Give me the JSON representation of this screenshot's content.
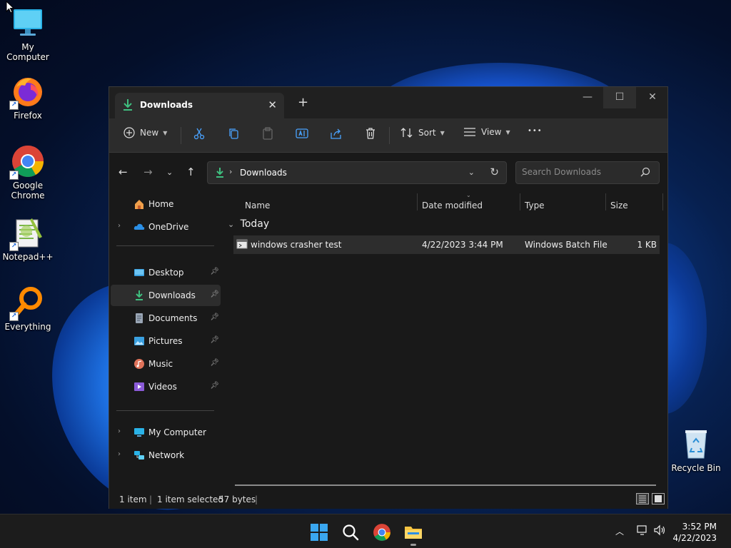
{
  "desktop": {
    "icons": [
      {
        "label": "My Computer",
        "icon": "monitor-icon"
      },
      {
        "label": "Firefox",
        "icon": "firefox-icon"
      },
      {
        "label": "Google Chrome",
        "icon": "chrome-icon"
      },
      {
        "label": "Notepad++",
        "icon": "notepadpp-icon"
      },
      {
        "label": "Everything",
        "icon": "everything-search-icon"
      },
      {
        "label": "Recycle Bin",
        "icon": "recycle-bin-icon"
      }
    ]
  },
  "window": {
    "tab_title": "Downloads",
    "new_tab_glyph": "+",
    "toolbar": {
      "new_label": "New",
      "sort_label": "Sort",
      "view_label": "View",
      "more_glyph": "•••"
    },
    "address": {
      "path": "Downloads"
    },
    "search": {
      "placeholder": "Search Downloads"
    },
    "sidebar": {
      "items": [
        {
          "label": "Home",
          "icon": "home-icon"
        },
        {
          "label": "OneDrive",
          "icon": "cloud-icon"
        },
        {
          "label": "Desktop",
          "icon": "desktop-folder-icon"
        },
        {
          "label": "Downloads",
          "icon": "download-icon"
        },
        {
          "label": "Documents",
          "icon": "documents-icon"
        },
        {
          "label": "Pictures",
          "icon": "pictures-icon"
        },
        {
          "label": "Music",
          "icon": "music-icon"
        },
        {
          "label": "Videos",
          "icon": "videos-icon"
        },
        {
          "label": "My Computer",
          "icon": "computer-icon"
        },
        {
          "label": "Network",
          "icon": "network-icon"
        }
      ]
    },
    "columns": [
      "Name",
      "Date modified",
      "Type",
      "Size"
    ],
    "group_label": "Today",
    "files": [
      {
        "name": "windows crasher test",
        "date": "4/22/2023 3:44 PM",
        "type": "Windows Batch File",
        "size": "1 KB"
      }
    ],
    "status": {
      "count": "1 item",
      "selected": "1 item selected",
      "bytes": "57 bytes"
    }
  },
  "taskbar": {
    "time": "3:52 PM",
    "date": "4/22/2023"
  }
}
